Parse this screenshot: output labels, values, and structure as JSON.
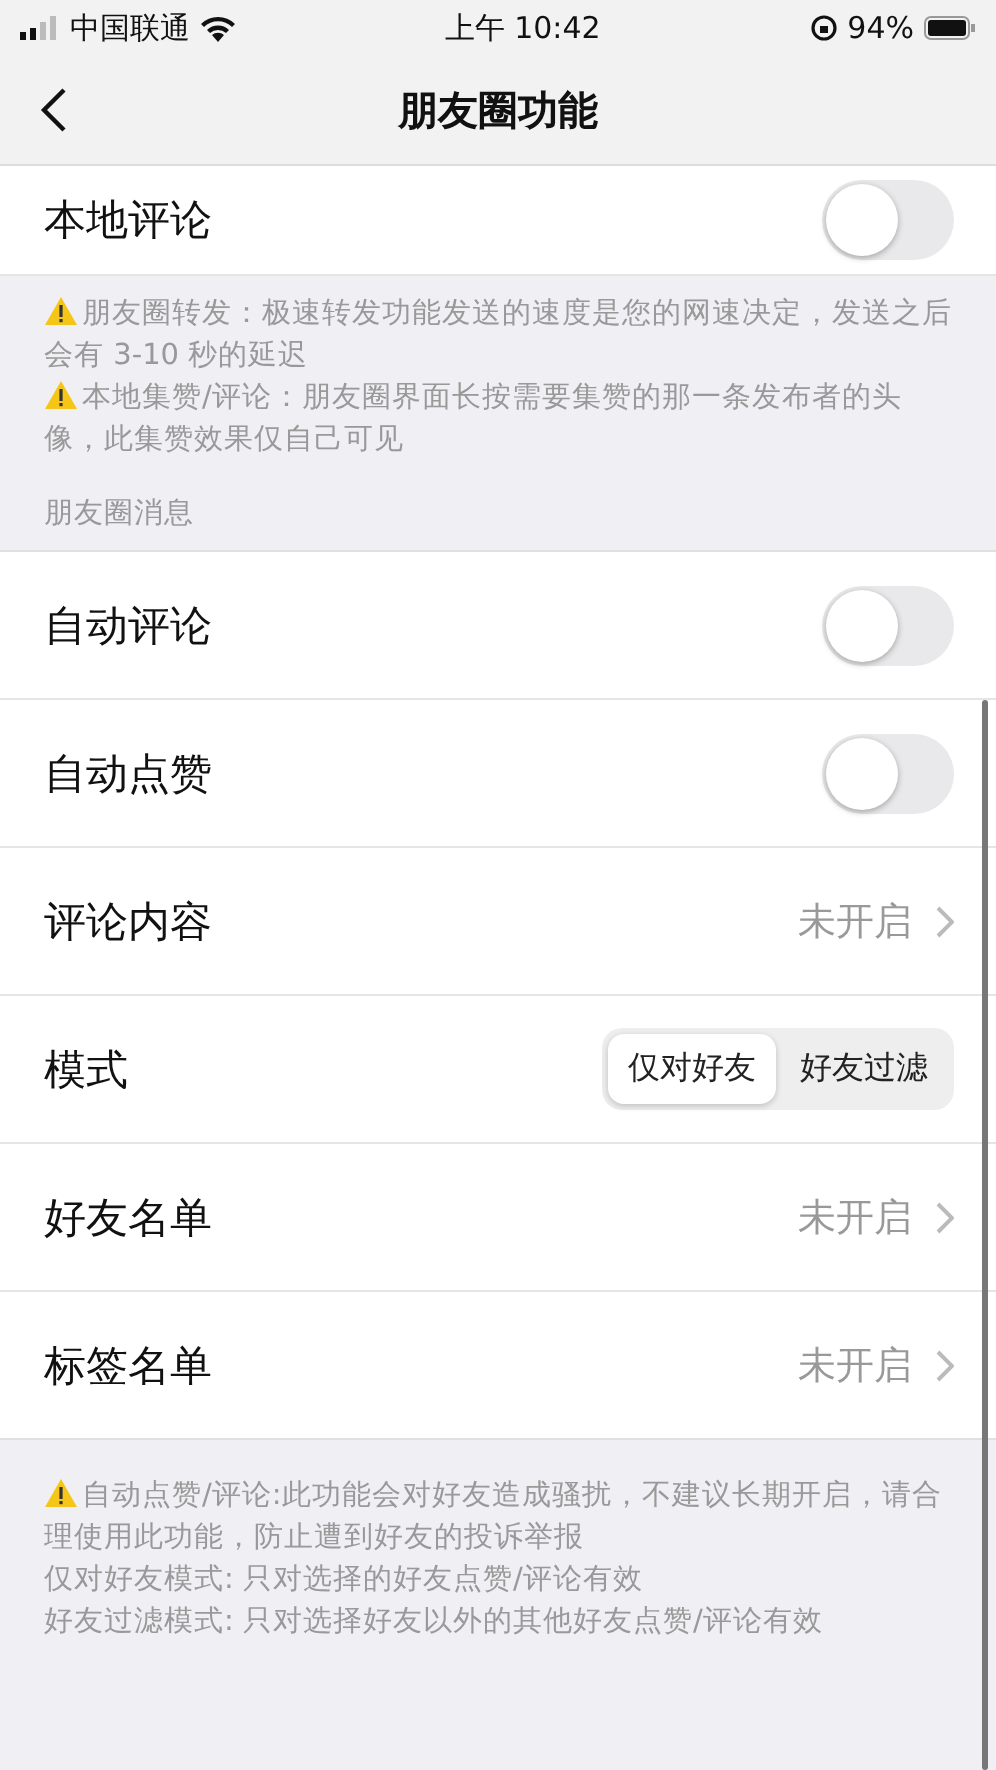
{
  "status_bar": {
    "carrier": "中国联通",
    "time": "上午 10:42",
    "battery": "94%"
  },
  "nav": {
    "title": "朋友圈功能"
  },
  "top_row": {
    "label": "本地评论",
    "kind": "toggle",
    "on": false
  },
  "notes_1": [
    {
      "text": "朋友圈转发：极速转发功能发送的速度是您的网速决定，发送之后会有 3-10 秒的延迟",
      "warning": true
    },
    {
      "text": "本地集赞/评论：朋友圈界面长按需要集赞的那一条发布者的头像，此集赞效果仅自己可见",
      "warning": true
    }
  ],
  "section_header": "朋友圈消息",
  "rows": [
    {
      "label": "自动评论",
      "kind": "toggle",
      "on": false
    },
    {
      "label": "自动点赞",
      "kind": "toggle",
      "on": false
    },
    {
      "label": "评论内容",
      "kind": "value",
      "value": "未开启"
    },
    {
      "label": "模式",
      "kind": "segmented",
      "options": [
        {
          "label": "仅对好友",
          "selected": true
        },
        {
          "label": "好友过滤",
          "selected": false
        }
      ]
    },
    {
      "label": "好友名单",
      "kind": "value",
      "value": "未开启"
    },
    {
      "label": "标签名单",
      "kind": "value",
      "value": "未开启"
    }
  ],
  "notes_2": [
    {
      "text": "自动点赞/评论:此功能会对好友造成骚扰，不建议长期开启，请合理使用此功能，防止遭到好友的投诉举报",
      "warning": true
    },
    {
      "text": "仅对好友模式: 只对选择的好友点赞/评论有效",
      "warning": false
    },
    {
      "text": "好友过滤模式: 只对选择好友以外的其他好友点赞/评论有效",
      "warning": false
    }
  ]
}
